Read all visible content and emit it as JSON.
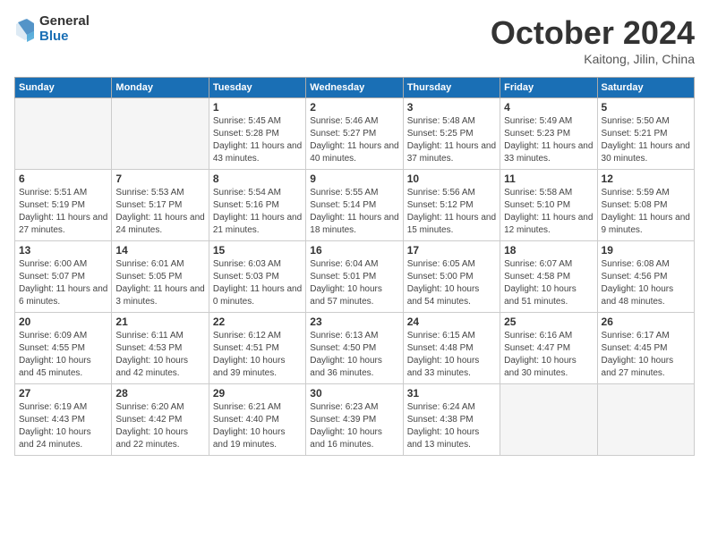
{
  "header": {
    "logo_general": "General",
    "logo_blue": "Blue",
    "month_title": "October 2024",
    "location": "Kaitong, Jilin, China"
  },
  "weekdays": [
    "Sunday",
    "Monday",
    "Tuesday",
    "Wednesday",
    "Thursday",
    "Friday",
    "Saturday"
  ],
  "weeks": [
    [
      {
        "day": "",
        "empty": true
      },
      {
        "day": "",
        "empty": true
      },
      {
        "day": "1",
        "sunrise": "Sunrise: 5:45 AM",
        "sunset": "Sunset: 5:28 PM",
        "daylight": "Daylight: 11 hours and 43 minutes."
      },
      {
        "day": "2",
        "sunrise": "Sunrise: 5:46 AM",
        "sunset": "Sunset: 5:27 PM",
        "daylight": "Daylight: 11 hours and 40 minutes."
      },
      {
        "day": "3",
        "sunrise": "Sunrise: 5:48 AM",
        "sunset": "Sunset: 5:25 PM",
        "daylight": "Daylight: 11 hours and 37 minutes."
      },
      {
        "day": "4",
        "sunrise": "Sunrise: 5:49 AM",
        "sunset": "Sunset: 5:23 PM",
        "daylight": "Daylight: 11 hours and 33 minutes."
      },
      {
        "day": "5",
        "sunrise": "Sunrise: 5:50 AM",
        "sunset": "Sunset: 5:21 PM",
        "daylight": "Daylight: 11 hours and 30 minutes."
      }
    ],
    [
      {
        "day": "6",
        "sunrise": "Sunrise: 5:51 AM",
        "sunset": "Sunset: 5:19 PM",
        "daylight": "Daylight: 11 hours and 27 minutes."
      },
      {
        "day": "7",
        "sunrise": "Sunrise: 5:53 AM",
        "sunset": "Sunset: 5:17 PM",
        "daylight": "Daylight: 11 hours and 24 minutes."
      },
      {
        "day": "8",
        "sunrise": "Sunrise: 5:54 AM",
        "sunset": "Sunset: 5:16 PM",
        "daylight": "Daylight: 11 hours and 21 minutes."
      },
      {
        "day": "9",
        "sunrise": "Sunrise: 5:55 AM",
        "sunset": "Sunset: 5:14 PM",
        "daylight": "Daylight: 11 hours and 18 minutes."
      },
      {
        "day": "10",
        "sunrise": "Sunrise: 5:56 AM",
        "sunset": "Sunset: 5:12 PM",
        "daylight": "Daylight: 11 hours and 15 minutes."
      },
      {
        "day": "11",
        "sunrise": "Sunrise: 5:58 AM",
        "sunset": "Sunset: 5:10 PM",
        "daylight": "Daylight: 11 hours and 12 minutes."
      },
      {
        "day": "12",
        "sunrise": "Sunrise: 5:59 AM",
        "sunset": "Sunset: 5:08 PM",
        "daylight": "Daylight: 11 hours and 9 minutes."
      }
    ],
    [
      {
        "day": "13",
        "sunrise": "Sunrise: 6:00 AM",
        "sunset": "Sunset: 5:07 PM",
        "daylight": "Daylight: 11 hours and 6 minutes."
      },
      {
        "day": "14",
        "sunrise": "Sunrise: 6:01 AM",
        "sunset": "Sunset: 5:05 PM",
        "daylight": "Daylight: 11 hours and 3 minutes."
      },
      {
        "day": "15",
        "sunrise": "Sunrise: 6:03 AM",
        "sunset": "Sunset: 5:03 PM",
        "daylight": "Daylight: 11 hours and 0 minutes."
      },
      {
        "day": "16",
        "sunrise": "Sunrise: 6:04 AM",
        "sunset": "Sunset: 5:01 PM",
        "daylight": "Daylight: 10 hours and 57 minutes."
      },
      {
        "day": "17",
        "sunrise": "Sunrise: 6:05 AM",
        "sunset": "Sunset: 5:00 PM",
        "daylight": "Daylight: 10 hours and 54 minutes."
      },
      {
        "day": "18",
        "sunrise": "Sunrise: 6:07 AM",
        "sunset": "Sunset: 4:58 PM",
        "daylight": "Daylight: 10 hours and 51 minutes."
      },
      {
        "day": "19",
        "sunrise": "Sunrise: 6:08 AM",
        "sunset": "Sunset: 4:56 PM",
        "daylight": "Daylight: 10 hours and 48 minutes."
      }
    ],
    [
      {
        "day": "20",
        "sunrise": "Sunrise: 6:09 AM",
        "sunset": "Sunset: 4:55 PM",
        "daylight": "Daylight: 10 hours and 45 minutes."
      },
      {
        "day": "21",
        "sunrise": "Sunrise: 6:11 AM",
        "sunset": "Sunset: 4:53 PM",
        "daylight": "Daylight: 10 hours and 42 minutes."
      },
      {
        "day": "22",
        "sunrise": "Sunrise: 6:12 AM",
        "sunset": "Sunset: 4:51 PM",
        "daylight": "Daylight: 10 hours and 39 minutes."
      },
      {
        "day": "23",
        "sunrise": "Sunrise: 6:13 AM",
        "sunset": "Sunset: 4:50 PM",
        "daylight": "Daylight: 10 hours and 36 minutes."
      },
      {
        "day": "24",
        "sunrise": "Sunrise: 6:15 AM",
        "sunset": "Sunset: 4:48 PM",
        "daylight": "Daylight: 10 hours and 33 minutes."
      },
      {
        "day": "25",
        "sunrise": "Sunrise: 6:16 AM",
        "sunset": "Sunset: 4:47 PM",
        "daylight": "Daylight: 10 hours and 30 minutes."
      },
      {
        "day": "26",
        "sunrise": "Sunrise: 6:17 AM",
        "sunset": "Sunset: 4:45 PM",
        "daylight": "Daylight: 10 hours and 27 minutes."
      }
    ],
    [
      {
        "day": "27",
        "sunrise": "Sunrise: 6:19 AM",
        "sunset": "Sunset: 4:43 PM",
        "daylight": "Daylight: 10 hours and 24 minutes."
      },
      {
        "day": "28",
        "sunrise": "Sunrise: 6:20 AM",
        "sunset": "Sunset: 4:42 PM",
        "daylight": "Daylight: 10 hours and 22 minutes."
      },
      {
        "day": "29",
        "sunrise": "Sunrise: 6:21 AM",
        "sunset": "Sunset: 4:40 PM",
        "daylight": "Daylight: 10 hours and 19 minutes."
      },
      {
        "day": "30",
        "sunrise": "Sunrise: 6:23 AM",
        "sunset": "Sunset: 4:39 PM",
        "daylight": "Daylight: 10 hours and 16 minutes."
      },
      {
        "day": "31",
        "sunrise": "Sunrise: 6:24 AM",
        "sunset": "Sunset: 4:38 PM",
        "daylight": "Daylight: 10 hours and 13 minutes."
      },
      {
        "day": "",
        "empty": true
      },
      {
        "day": "",
        "empty": true
      }
    ]
  ]
}
